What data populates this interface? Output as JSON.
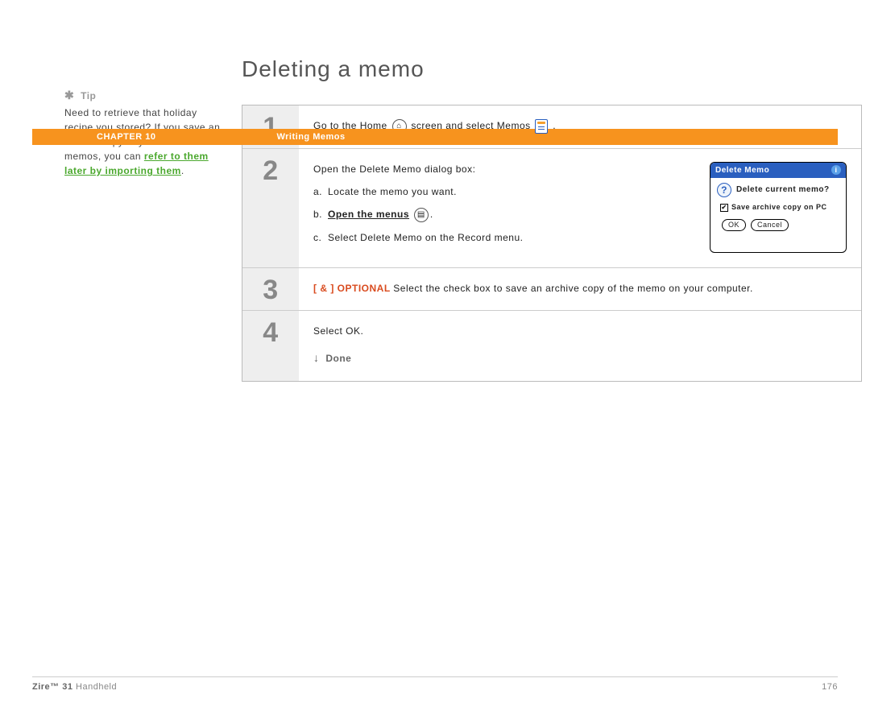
{
  "header": {
    "chapter": "CHAPTER 10",
    "breadcrumb": "Writing Memos"
  },
  "sidebar": {
    "tip_label": "Tip",
    "tip_body": "Need to retrieve that holiday recipe you stored? If you save an archive copy of your deleted memos, you can ",
    "tip_link": "refer to them later by importing them",
    "tip_after": "."
  },
  "main": {
    "title": "Deleting a memo",
    "step1": {
      "pre": "Go to the Home ",
      "mid": " screen and select Memos ",
      "post": "."
    },
    "step2": {
      "intro": "Open the Delete Memo dialog box:",
      "a": "Locate the memo you want.",
      "b_label": "Open the menus",
      "b_after": ".",
      "c": "Select Delete Memo on the Record menu.",
      "dialog": {
        "title": "Delete Memo",
        "question": "Delete current memo?",
        "checkbox": "Save archive copy on PC",
        "ok": "OK",
        "cancel": "Cancel"
      }
    },
    "step3": {
      "tag_open": "[ & ]",
      "tag_label": " OPTIONAL",
      "body": "   Select the check box to save an archive copy of the memo on your computer."
    },
    "step4": {
      "body": "Select OK.",
      "done": "Done"
    },
    "nums": {
      "n1": "1",
      "n2": "2",
      "n3": "3",
      "n4": "4"
    }
  },
  "footer": {
    "product_bold": "Zire™ 31",
    "product_rest": " Handheld",
    "page": "176"
  }
}
